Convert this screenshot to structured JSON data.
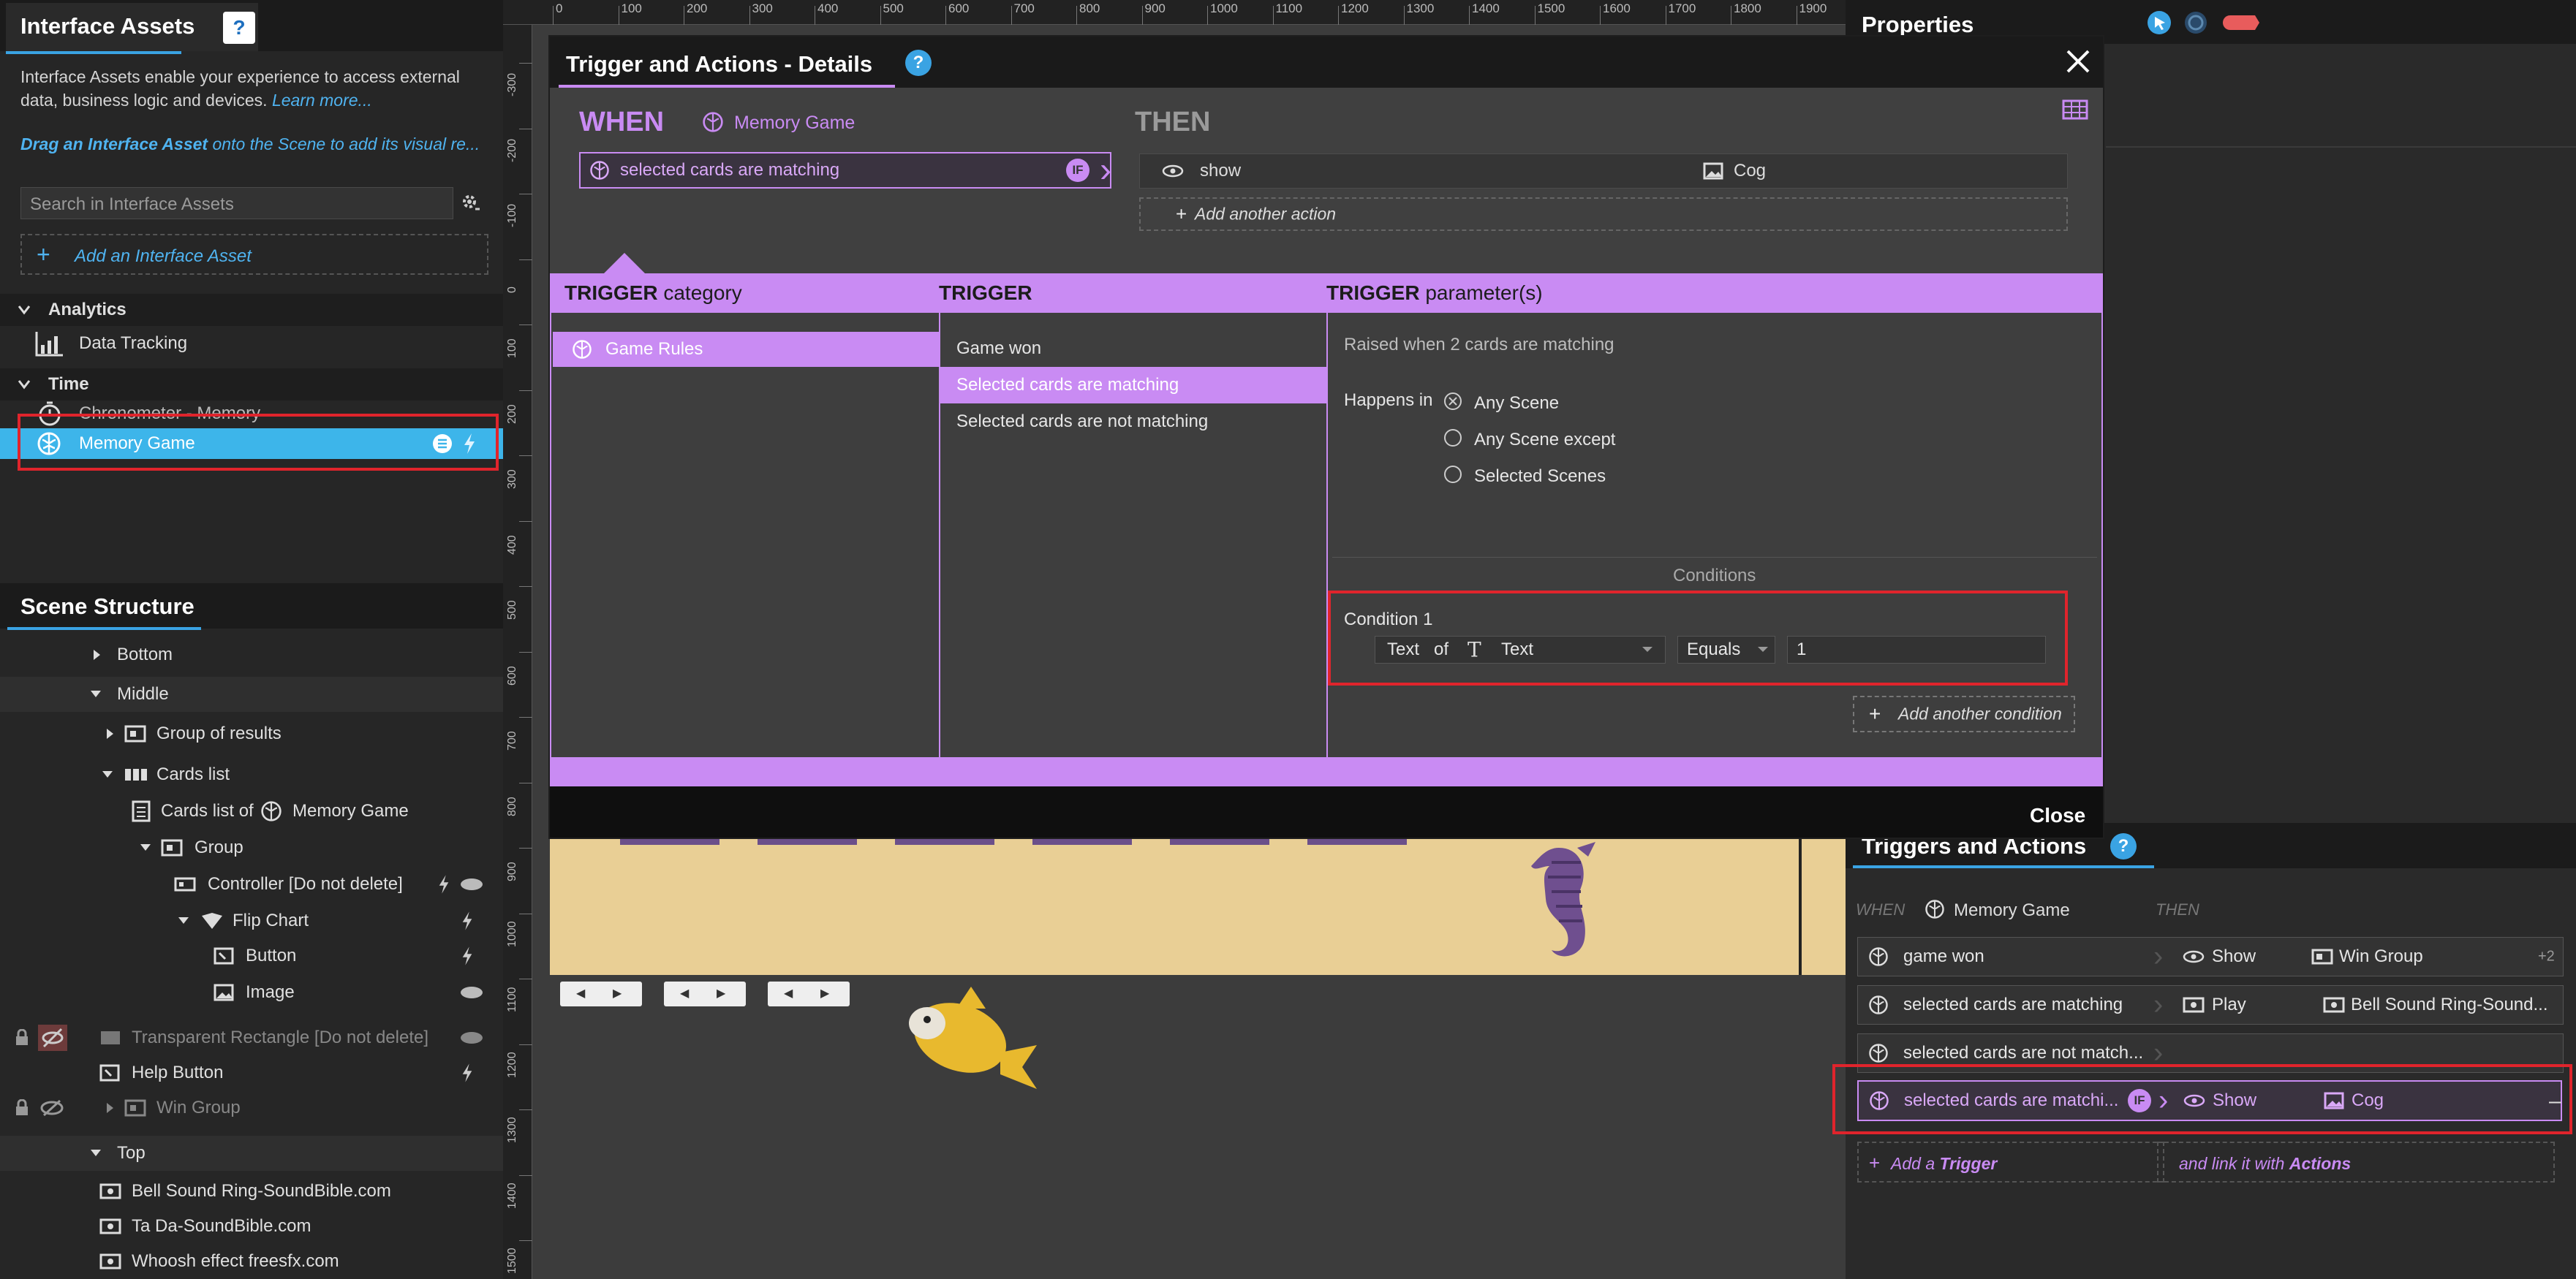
{
  "interface_assets": {
    "title": "Interface Assets",
    "help": "?",
    "description_line1": "Interface Assets enable your experience to access external",
    "description_line2": "data, business logic and devices.",
    "learn_more": "Learn more...",
    "drag_bold": "Drag an Interface Asset",
    "drag_rest": "onto the Scene to add its visual re...",
    "search_placeholder": "Search in Interface Assets",
    "add_label": "Add an Interface Asset",
    "groups": [
      {
        "label": "Analytics",
        "items": [
          {
            "label": "Data Tracking"
          }
        ]
      },
      {
        "label": "Time",
        "items": [
          {
            "label": "Chronometer - Memory"
          },
          {
            "label": "Memory Game"
          }
        ]
      }
    ]
  },
  "scene_structure": {
    "title": "Scene Structure",
    "items": [
      {
        "label": "Bottom"
      },
      {
        "label": "Middle"
      },
      {
        "label": "Group of results"
      },
      {
        "label": "Cards list"
      },
      {
        "label": "Cards list of"
      },
      {
        "label": "Memory Game"
      },
      {
        "label": "Group"
      },
      {
        "label": "Controller [Do not delete]"
      },
      {
        "label": "Flip Chart"
      },
      {
        "label": "Button"
      },
      {
        "label": "Image"
      },
      {
        "label": "Transparent Rectangle [Do not delete]"
      },
      {
        "label": "Help Button"
      },
      {
        "label": "Win Group"
      },
      {
        "label": "Top"
      },
      {
        "label": "Bell Sound Ring-SoundBible.com"
      },
      {
        "label": "Ta Da-SoundBible.com"
      },
      {
        "label": "Whoosh effect freesfx.com"
      }
    ]
  },
  "ruler": {
    "h": [
      "0",
      "100",
      "200",
      "300",
      "400",
      "500",
      "600",
      "700",
      "800",
      "900",
      "1000",
      "1100",
      "1200",
      "1300",
      "1400",
      "1500",
      "1600",
      "1700",
      "1800",
      "1900"
    ],
    "v": [
      "-300",
      "-200",
      "-100",
      "0",
      "100",
      "200",
      "300",
      "400",
      "500",
      "600",
      "700",
      "800",
      "900",
      "1000",
      "1100",
      "1200",
      "1300",
      "1400",
      "1500"
    ]
  },
  "dialog": {
    "title": "Trigger and Actions - Details",
    "help": "?",
    "when_label": "WHEN",
    "when_asset": "Memory Game",
    "trigger_value": "selected cards are matching",
    "if_badge": "IF",
    "then_label": "THEN",
    "action_verb": "show",
    "action_target": "Cog",
    "add_action": "Add another action",
    "col_category": {
      "bold": "TRIGGER",
      "rest": "category"
    },
    "col_trigger": {
      "bold": "TRIGGER",
      "rest": ""
    },
    "col_params": {
      "bold": "TRIGGER",
      "rest": "parameter(s)"
    },
    "category_items": [
      "Game Rules"
    ],
    "trigger_items": [
      "Game won",
      "Selected cards are matching",
      "Selected cards are not matching"
    ],
    "description": "Raised when 2 cards are matching",
    "happens_in_label": "Happens in",
    "scene_options": [
      "Any Scene",
      "Any Scene except",
      "Selected Scenes"
    ],
    "conditions_label": "Conditions",
    "condition_title": "Condition 1",
    "condition_field": "Text",
    "condition_of": "of",
    "condition_object": "Text",
    "condition_operator": "Equals",
    "condition_value": "1",
    "add_condition": "Add another condition",
    "close_label": "Close"
  },
  "properties": {
    "title": "Properties"
  },
  "triggers_panel": {
    "title": "Triggers and Actions",
    "help": "?",
    "when": "WHEN",
    "asset": "Memory Game",
    "then": "THEN",
    "rows": [
      {
        "trigger": "game won",
        "verb": "Show",
        "target": "Win Group",
        "extra": "+2"
      },
      {
        "trigger": "selected cards are matching",
        "verb": "Play",
        "target": "Bell Sound Ring-Sound...",
        "extra": ""
      },
      {
        "trigger": "selected cards are not match...",
        "verb": "",
        "target": "",
        "extra": ""
      },
      {
        "trigger": "selected cards are matchi...",
        "verb": "Show",
        "target": "Cog",
        "extra": ""
      }
    ],
    "if_badge": "IF",
    "add_trigger_prefix": "Add a",
    "add_trigger_bold": "Trigger",
    "link_prefix": "and link it with",
    "link_bold": "Actions",
    "remove": "–"
  },
  "colors": {
    "accent": "#c98bf3",
    "selection": "#3db5ea",
    "highlight": "#e0242c",
    "help": "#3aa3e3"
  }
}
